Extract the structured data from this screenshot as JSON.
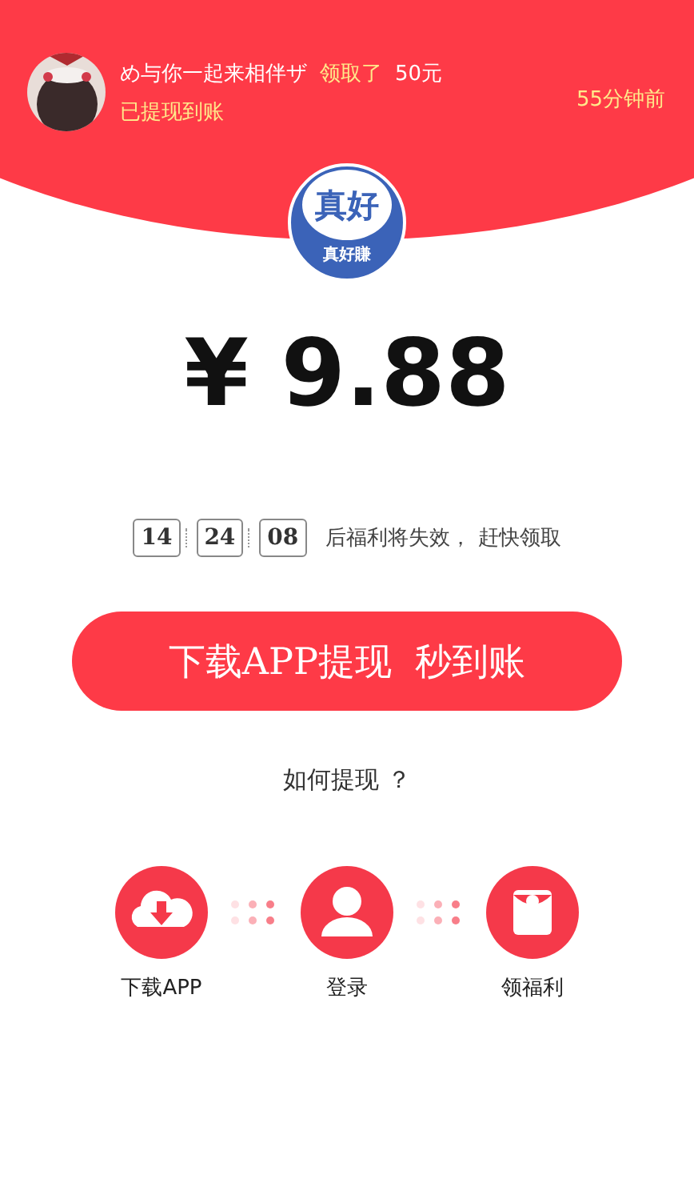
{
  "notice": {
    "user": "め与你一起来相伴ザ",
    "action": "领取了",
    "amount": "50元",
    "status": "已提现到账",
    "time": "55分钟前"
  },
  "logo": {
    "title": "真好",
    "subtitle": "真好賺"
  },
  "amount": "¥ 9.88",
  "countdown": {
    "digits": [
      "14",
      "24",
      "08"
    ],
    "message": "后福利将失效， 赶快领取"
  },
  "cta": "下载APP提现  秒到账",
  "help": "如何提现 ？",
  "steps": [
    {
      "kind": "download",
      "label": "下载APP"
    },
    {
      "kind": "login",
      "label": "登录"
    },
    {
      "kind": "redpacket",
      "label": "领福利"
    }
  ]
}
